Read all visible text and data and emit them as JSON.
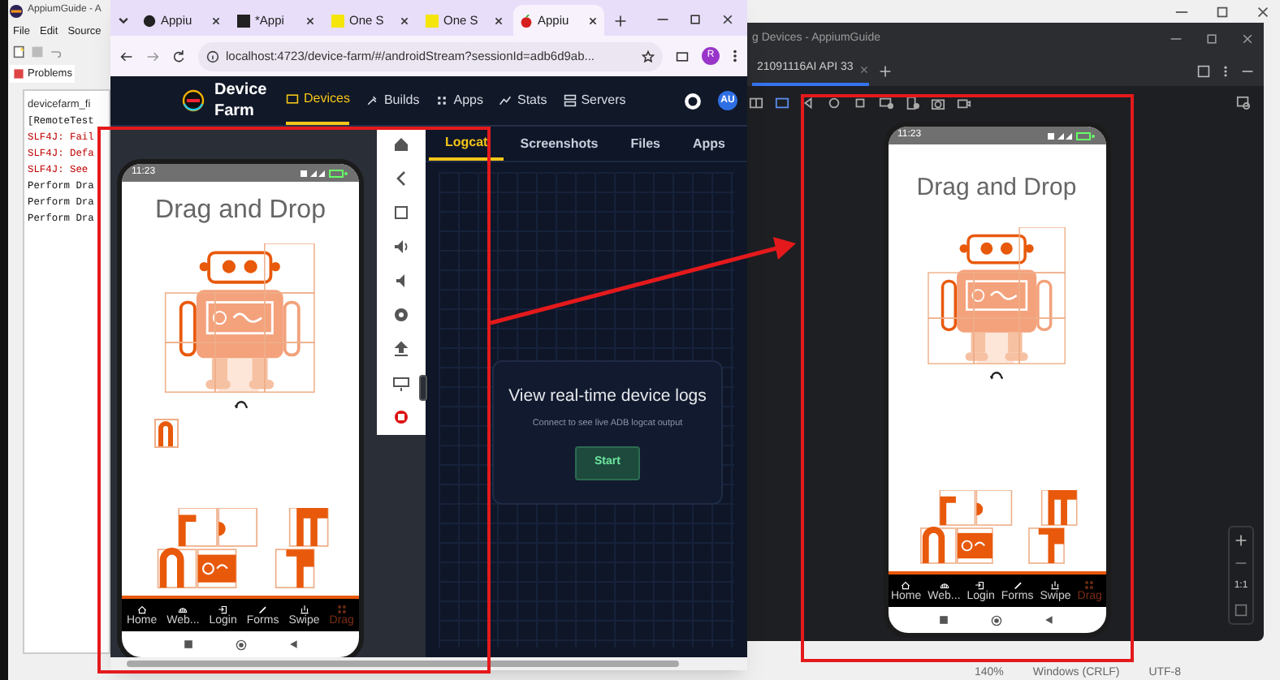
{
  "ide": {
    "title": "AppiumGuide - A",
    "menu": [
      "File",
      "Edit",
      "Source"
    ],
    "view_tab": "Problems",
    "console_title": "devicefarm_fi",
    "console_lines": [
      {
        "text": "[RemoteTest",
        "kind": "normal"
      },
      {
        "text": "SLF4J: Fail",
        "kind": "error"
      },
      {
        "text": "SLF4J: Defa",
        "kind": "error"
      },
      {
        "text": "SLF4J: See",
        "kind": "error"
      },
      {
        "text": "Perform Dra",
        "kind": "normal"
      },
      {
        "text": "Perform Dra",
        "kind": "normal"
      },
      {
        "text": "Perform Dra",
        "kind": "normal"
      }
    ],
    "status_bar": [
      "140%",
      "Windows (CRLF)",
      "UTF-8"
    ]
  },
  "browser": {
    "tabs": [
      {
        "title": "Appiu",
        "selected": false
      },
      {
        "title": "*Appi",
        "selected": false
      },
      {
        "title": "One S",
        "selected": false
      },
      {
        "title": "One S",
        "selected": false
      },
      {
        "title": "Appiu",
        "selected": true
      }
    ],
    "url": "localhost:4723/device-farm/#/androidStream?sessionId=adb6d9ab...",
    "profile": "R"
  },
  "device_farm": {
    "brand": "Device Farm",
    "nav": [
      {
        "label": "Devices",
        "selected": true
      },
      {
        "label": "Builds",
        "selected": false
      },
      {
        "label": "Apps",
        "selected": false
      },
      {
        "label": "Stats",
        "selected": false
      },
      {
        "label": "Servers",
        "selected": false
      }
    ],
    "user": "AU",
    "stream_phone": {
      "time": "11:23",
      "title": "Drag and Drop",
      "tabs": [
        {
          "label": "Home",
          "selected": false
        },
        {
          "label": "Web...",
          "selected": false
        },
        {
          "label": "Login",
          "selected": false
        },
        {
          "label": "Forms",
          "selected": false
        },
        {
          "label": "Swipe",
          "selected": false
        },
        {
          "label": "Drag",
          "selected": true
        }
      ]
    },
    "panel_tabs": [
      {
        "label": "Logcat",
        "selected": true
      },
      {
        "label": "Screenshots",
        "selected": false
      },
      {
        "label": "Files",
        "selected": false
      },
      {
        "label": "Apps",
        "selected": false
      }
    ],
    "empty_title": "View real-time device logs",
    "empty_text": "Connect to see live ADB logcat output",
    "start_button": "Start"
  },
  "emulator": {
    "window_title": "g Devices - AppiumGuide",
    "device_tab": "21091116AI API 33",
    "zoom_label": "1:1",
    "phone": {
      "time": "11:23",
      "title": "Drag and Drop",
      "tabs": [
        {
          "label": "Home",
          "selected": false
        },
        {
          "label": "Web...",
          "selected": false
        },
        {
          "label": "Login",
          "selected": false
        },
        {
          "label": "Forms",
          "selected": false
        },
        {
          "label": "Swipe",
          "selected": false
        },
        {
          "label": "Drag",
          "selected": true
        }
      ]
    }
  }
}
